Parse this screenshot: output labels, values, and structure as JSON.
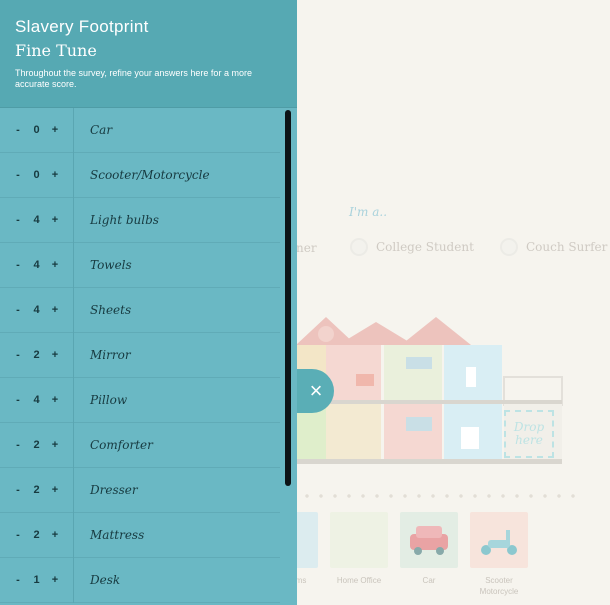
{
  "panel": {
    "app_title": "Slavery Footprint",
    "section_title": "Fine Tune",
    "description": "Throughout the survey, refine your answers here for a more accurate score.",
    "items": [
      {
        "label": "Car",
        "count": "0"
      },
      {
        "label": "Scooter/Motorcycle",
        "count": "0"
      },
      {
        "label": "Light bulbs",
        "count": "4"
      },
      {
        "label": "Towels",
        "count": "4"
      },
      {
        "label": "Sheets",
        "count": "4"
      },
      {
        "label": "Mirror",
        "count": "2"
      },
      {
        "label": "Pillow",
        "count": "4"
      },
      {
        "label": "Comforter",
        "count": "2"
      },
      {
        "label": "Dresser",
        "count": "2"
      },
      {
        "label": "Mattress",
        "count": "2"
      },
      {
        "label": "Desk",
        "count": "1"
      }
    ],
    "minus": "-",
    "plus": "+",
    "close": "×"
  },
  "background": {
    "prompt": "I'm a..",
    "option_partial": "ner",
    "option_college": "College Student",
    "option_couch": "Couch Surfer",
    "drop_zone": "Drop here",
    "tiles": [
      "ms",
      "Home Office",
      "Car",
      "Scooter Motorcycle"
    ]
  },
  "colors": {
    "panel": "#6ab8c4",
    "header": "#56a9b3",
    "text_dark": "#173a40",
    "page_bg": "#f6f4ee"
  }
}
